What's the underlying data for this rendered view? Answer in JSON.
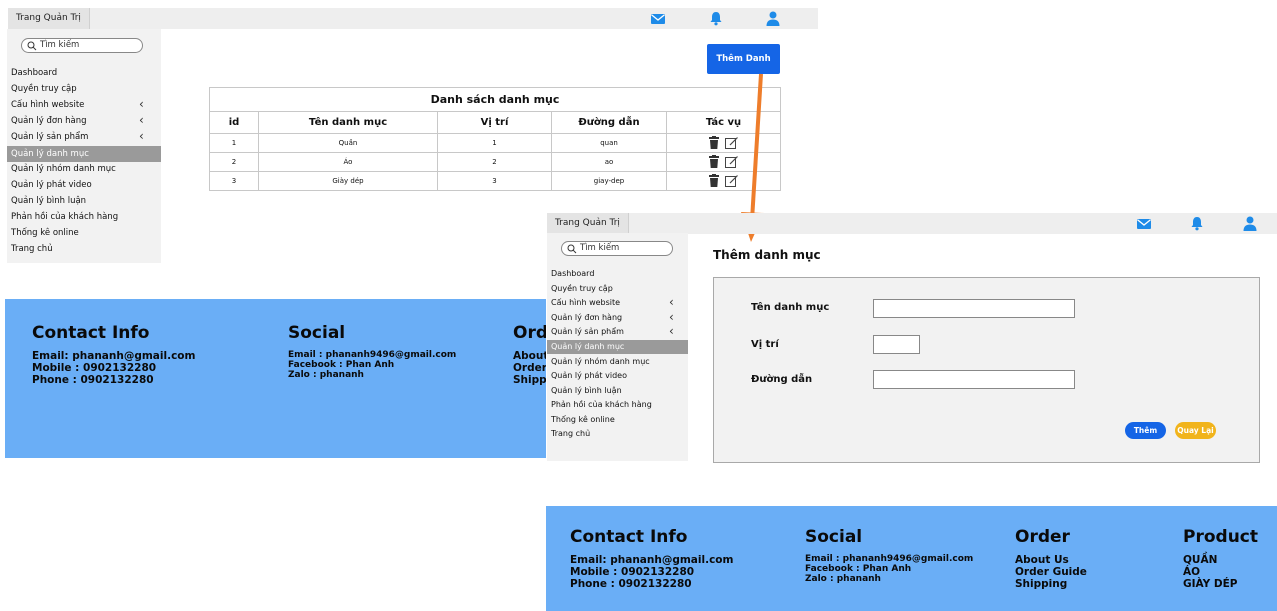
{
  "top_bar": {
    "tab_label": "Trang Quản Trị",
    "icons": [
      "mail-icon",
      "bell-icon",
      "user-icon"
    ]
  },
  "sidebar": {
    "search_placeholder": "Tìm kiếm",
    "items": [
      {
        "label": "Dashboard",
        "chevron": false
      },
      {
        "label": "Quyền truy cập",
        "chevron": false
      },
      {
        "label": "Cấu hình website",
        "chevron": true
      },
      {
        "label": "Quản lý đơn hàng",
        "chevron": true
      },
      {
        "label": "Quản lý sản phẩm",
        "chevron": true
      },
      {
        "label": "Quản lý danh mục",
        "chevron": false,
        "active": true
      },
      {
        "label": "Quản lý nhóm danh mục",
        "chevron": false
      },
      {
        "label": "Quản lý phát video",
        "chevron": false
      },
      {
        "label": "Quản lý bình luận",
        "chevron": false
      },
      {
        "label": "Phản hồi của khách hàng",
        "chevron": false
      },
      {
        "label": "Thống kê online",
        "chevron": false
      },
      {
        "label": "Trang chủ",
        "chevron": false
      }
    ]
  },
  "list_page": {
    "add_button": "Thêm Danh Mục",
    "table_title": "Danh sách danh mục",
    "columns": [
      "id",
      "Tên danh mục",
      "Vị trí",
      "Đường dẫn",
      "Tác vụ"
    ],
    "rows": [
      {
        "id": "1",
        "name": "Quần",
        "position": "1",
        "slug": "quan"
      },
      {
        "id": "2",
        "name": "Áo",
        "position": "2",
        "slug": "ao"
      },
      {
        "id": "3",
        "name": "Giày dép",
        "position": "3",
        "slug": "giay-dep"
      }
    ]
  },
  "footer": {
    "contact": {
      "heading": "Contact Info",
      "email": "Email: phananh@gmail.com",
      "mobile": "Mobile : 0902132280",
      "phone": "Phone : 0902132280"
    },
    "social": {
      "heading": "Social",
      "email": "Email : phananh9496@gmail.com",
      "facebook": "Facebook : Phan Anh",
      "zalo": "Zalo : phananh"
    },
    "order": {
      "heading": "Order",
      "links": [
        "About Us",
        "Order Guide",
        "Shipping"
      ]
    },
    "product": {
      "heading": "Product",
      "links": [
        "QUẦN",
        "ÁO",
        "GIÀY DÉP"
      ]
    }
  },
  "add_form": {
    "title": "Thêm danh mục",
    "fields": {
      "name_label": "Tên danh mục",
      "position_label": "Vị trí",
      "slug_label": "Đường dẫn",
      "name_value": "",
      "position_value": "",
      "slug_value": ""
    },
    "submit": "Thêm",
    "back": "Quay Lại"
  },
  "colors": {
    "primary_blue": "#1565e6",
    "footer_blue": "#6aaef6",
    "arrow_orange": "#ee7d2b",
    "back_yellow": "#f1b41c",
    "icon_blue": "#1e8be8"
  }
}
